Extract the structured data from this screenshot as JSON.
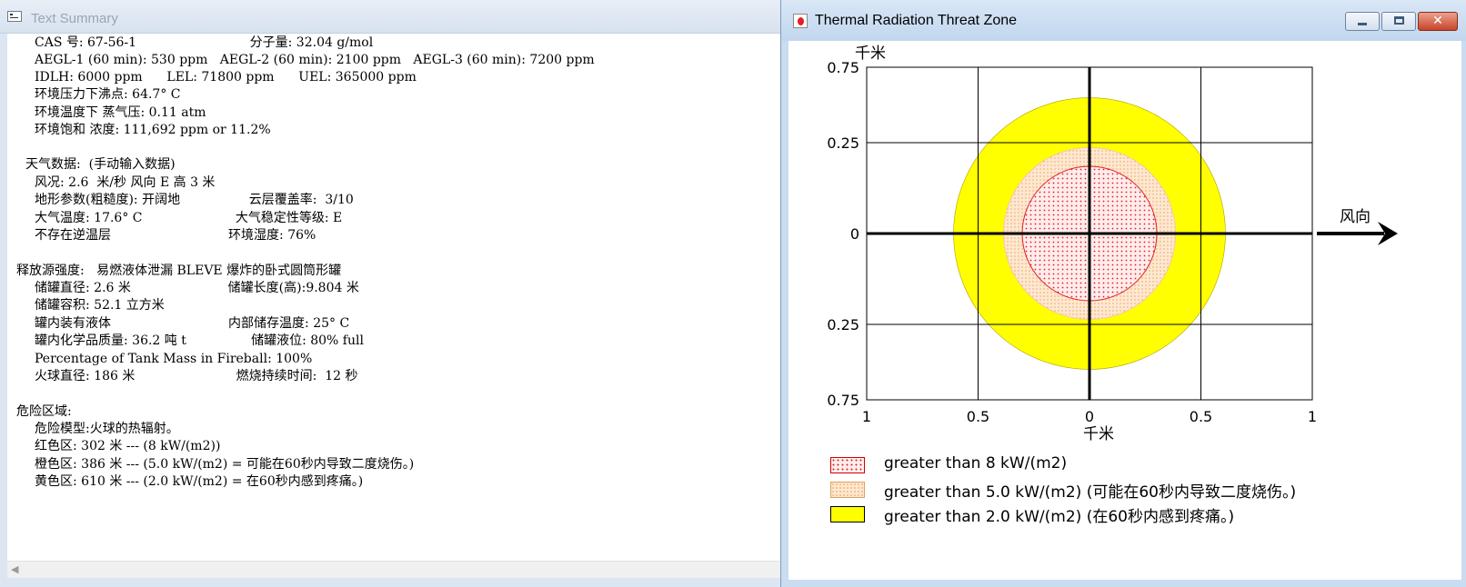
{
  "left_window": {
    "title": "Text Summary",
    "lines": [
      "CAS 号: 67-56-1                            分子量: 32.04 g/mol",
      "AEGL-1 (60 min): 530 ppm   AEGL-2 (60 min): 2100 ppm   AEGL-3 (60 min): 7200 ppm",
      "IDLH: 6000 ppm      LEL: 71800 ppm      UEL: 365000 ppm",
      "环境压力下沸点: 64.7° C",
      "环境温度下 蒸气压: 0.11 atm",
      "环境饱和 浓度: 111,692 ppm or 11.2%",
      "",
      "天气数据:  (手动输入数据)",
      "风况: 2.6  米/秒 风向 E 高 3 米",
      "地形参数(粗糙度): 开阔地                 云层覆盖率:  3/10",
      "大气温度: 17.6° C                       大气稳定性等级: E",
      "不存在逆温层                             环境湿度: 76%",
      "",
      "释放源强度:   易燃液体泄漏 BLEVE 爆炸的卧式圆筒形罐",
      "储罐直径: 2.6 米                        储罐长度(高):9.804 米",
      "储罐容积: 52.1 立方米",
      "罐内装有液体                             内部储存温度: 25° C",
      "罐内化学品质量: 36.2 吨 t                储罐液位: 80% full",
      "Percentage of Tank Mass in Fireball: 100%",
      "火球直径: 186 米                         燃烧持续时间:  12 秒",
      "",
      "危险区域:",
      "危险模型:火球的热辐射。",
      "红色区: 302 米 --- (8 kW/(m2))",
      "橙色区: 386 米 --- (5.0 kW/(m2) = 可能在60秒内导致二度烧伤。)",
      "黄色区: 610 米 --- (2.0 kW/(m2) = 在60秒内感到疼痛。)"
    ]
  },
  "right_window": {
    "title": "Thermal Radiation Threat Zone",
    "buttons": {
      "minimize": "",
      "maximize": "",
      "close": "✕"
    },
    "wind_label": "风向",
    "y_unit": "千米",
    "x_unit": "千米",
    "y_ticks": [
      "0.75",
      "0.25",
      "0",
      "0.25",
      "0.75"
    ],
    "x_ticks": [
      "1",
      "0.5",
      "0",
      "0.5",
      "1"
    ],
    "legend": [
      {
        "label": "greater than 8 kW/(m2)",
        "color": "#ff0000"
      },
      {
        "label": "greater than 5.0 kW/(m2) (可能在60秒内导致二度烧伤。)",
        "color": "#ffa500"
      },
      {
        "label": "greater than 2.0 kW/(m2) (在60秒内感到疼痛。)",
        "color": "#ffff00"
      }
    ]
  },
  "chart_data": {
    "type": "area",
    "x_unit": "千米",
    "y_unit": "千米",
    "xlim": [
      -1,
      1
    ],
    "ylim": [
      -0.75,
      0.75
    ],
    "x_tick_labels": [
      "1",
      "0.5",
      "0",
      "0.5",
      "1"
    ],
    "y_tick_labels": [
      "0.75",
      "0.25",
      "0",
      "0.25",
      "0.75"
    ],
    "grid": true,
    "zones": [
      {
        "name": "greater than 8 kW/(m2)",
        "radius_km": 0.302,
        "fill": "red-dotted"
      },
      {
        "name": "greater than 5.0 kW/(m2) (可能在60秒内导致二度烧伤。)",
        "radius_km": 0.386,
        "fill": "orange-dotted"
      },
      {
        "name": "greater than 2.0 kW/(m2) (在60秒内感到疼痛。)",
        "radius_km": 0.61,
        "fill": "yellow"
      }
    ]
  }
}
